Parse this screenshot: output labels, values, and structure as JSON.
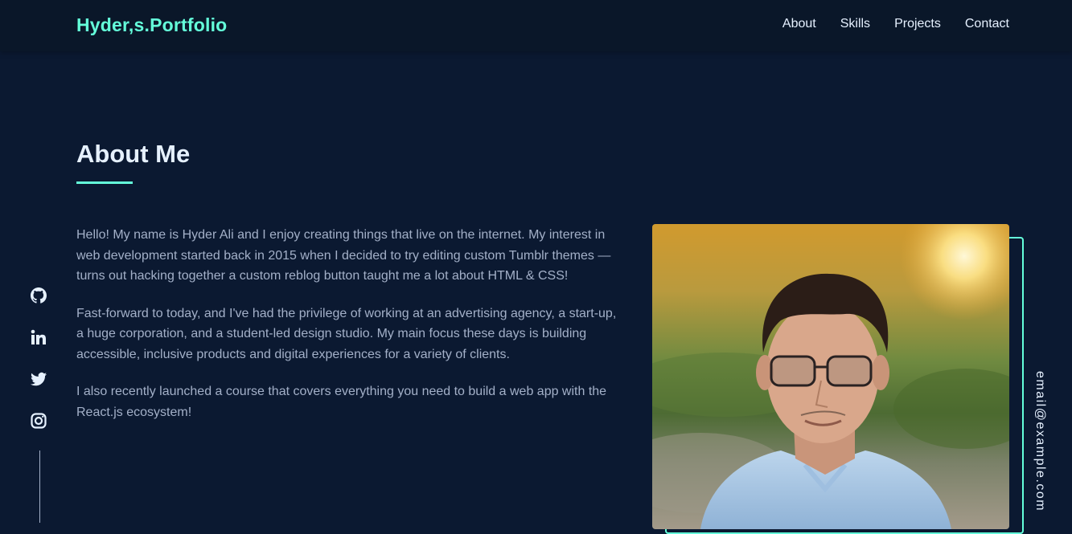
{
  "nav": {
    "logo": "Hyder,s.Portfolio",
    "links": [
      "About",
      "Skills",
      "Projects",
      "Contact"
    ]
  },
  "about": {
    "title": "About Me",
    "paragraphs": [
      "Hello! My name is Hyder Ali and I enjoy creating things that live on the internet. My interest in web development started back in 2015 when I decided to try editing custom Tumblr themes — turns out hacking together a custom reblog button taught me a lot about HTML & CSS!",
      "Fast-forward to today, and I've had the privilege of working at an advertising agency, a start-up, a huge corporation, and a student-led design studio. My main focus these days is building accessible, inclusive products and digital experiences for a variety of clients.",
      "I also recently launched a course that covers everything you need to build a web app with the React.js ecosystem!"
    ]
  },
  "social": {
    "icons": [
      "github-icon",
      "linkedin-icon",
      "twitter-icon",
      "instagram-icon"
    ]
  },
  "email": "email@example.com",
  "colors": {
    "accent": "#64ffda",
    "background": "#0b1931",
    "navbar": "#0a1729",
    "heading": "#e6f1ff",
    "body_text": "#a3b0c8"
  }
}
